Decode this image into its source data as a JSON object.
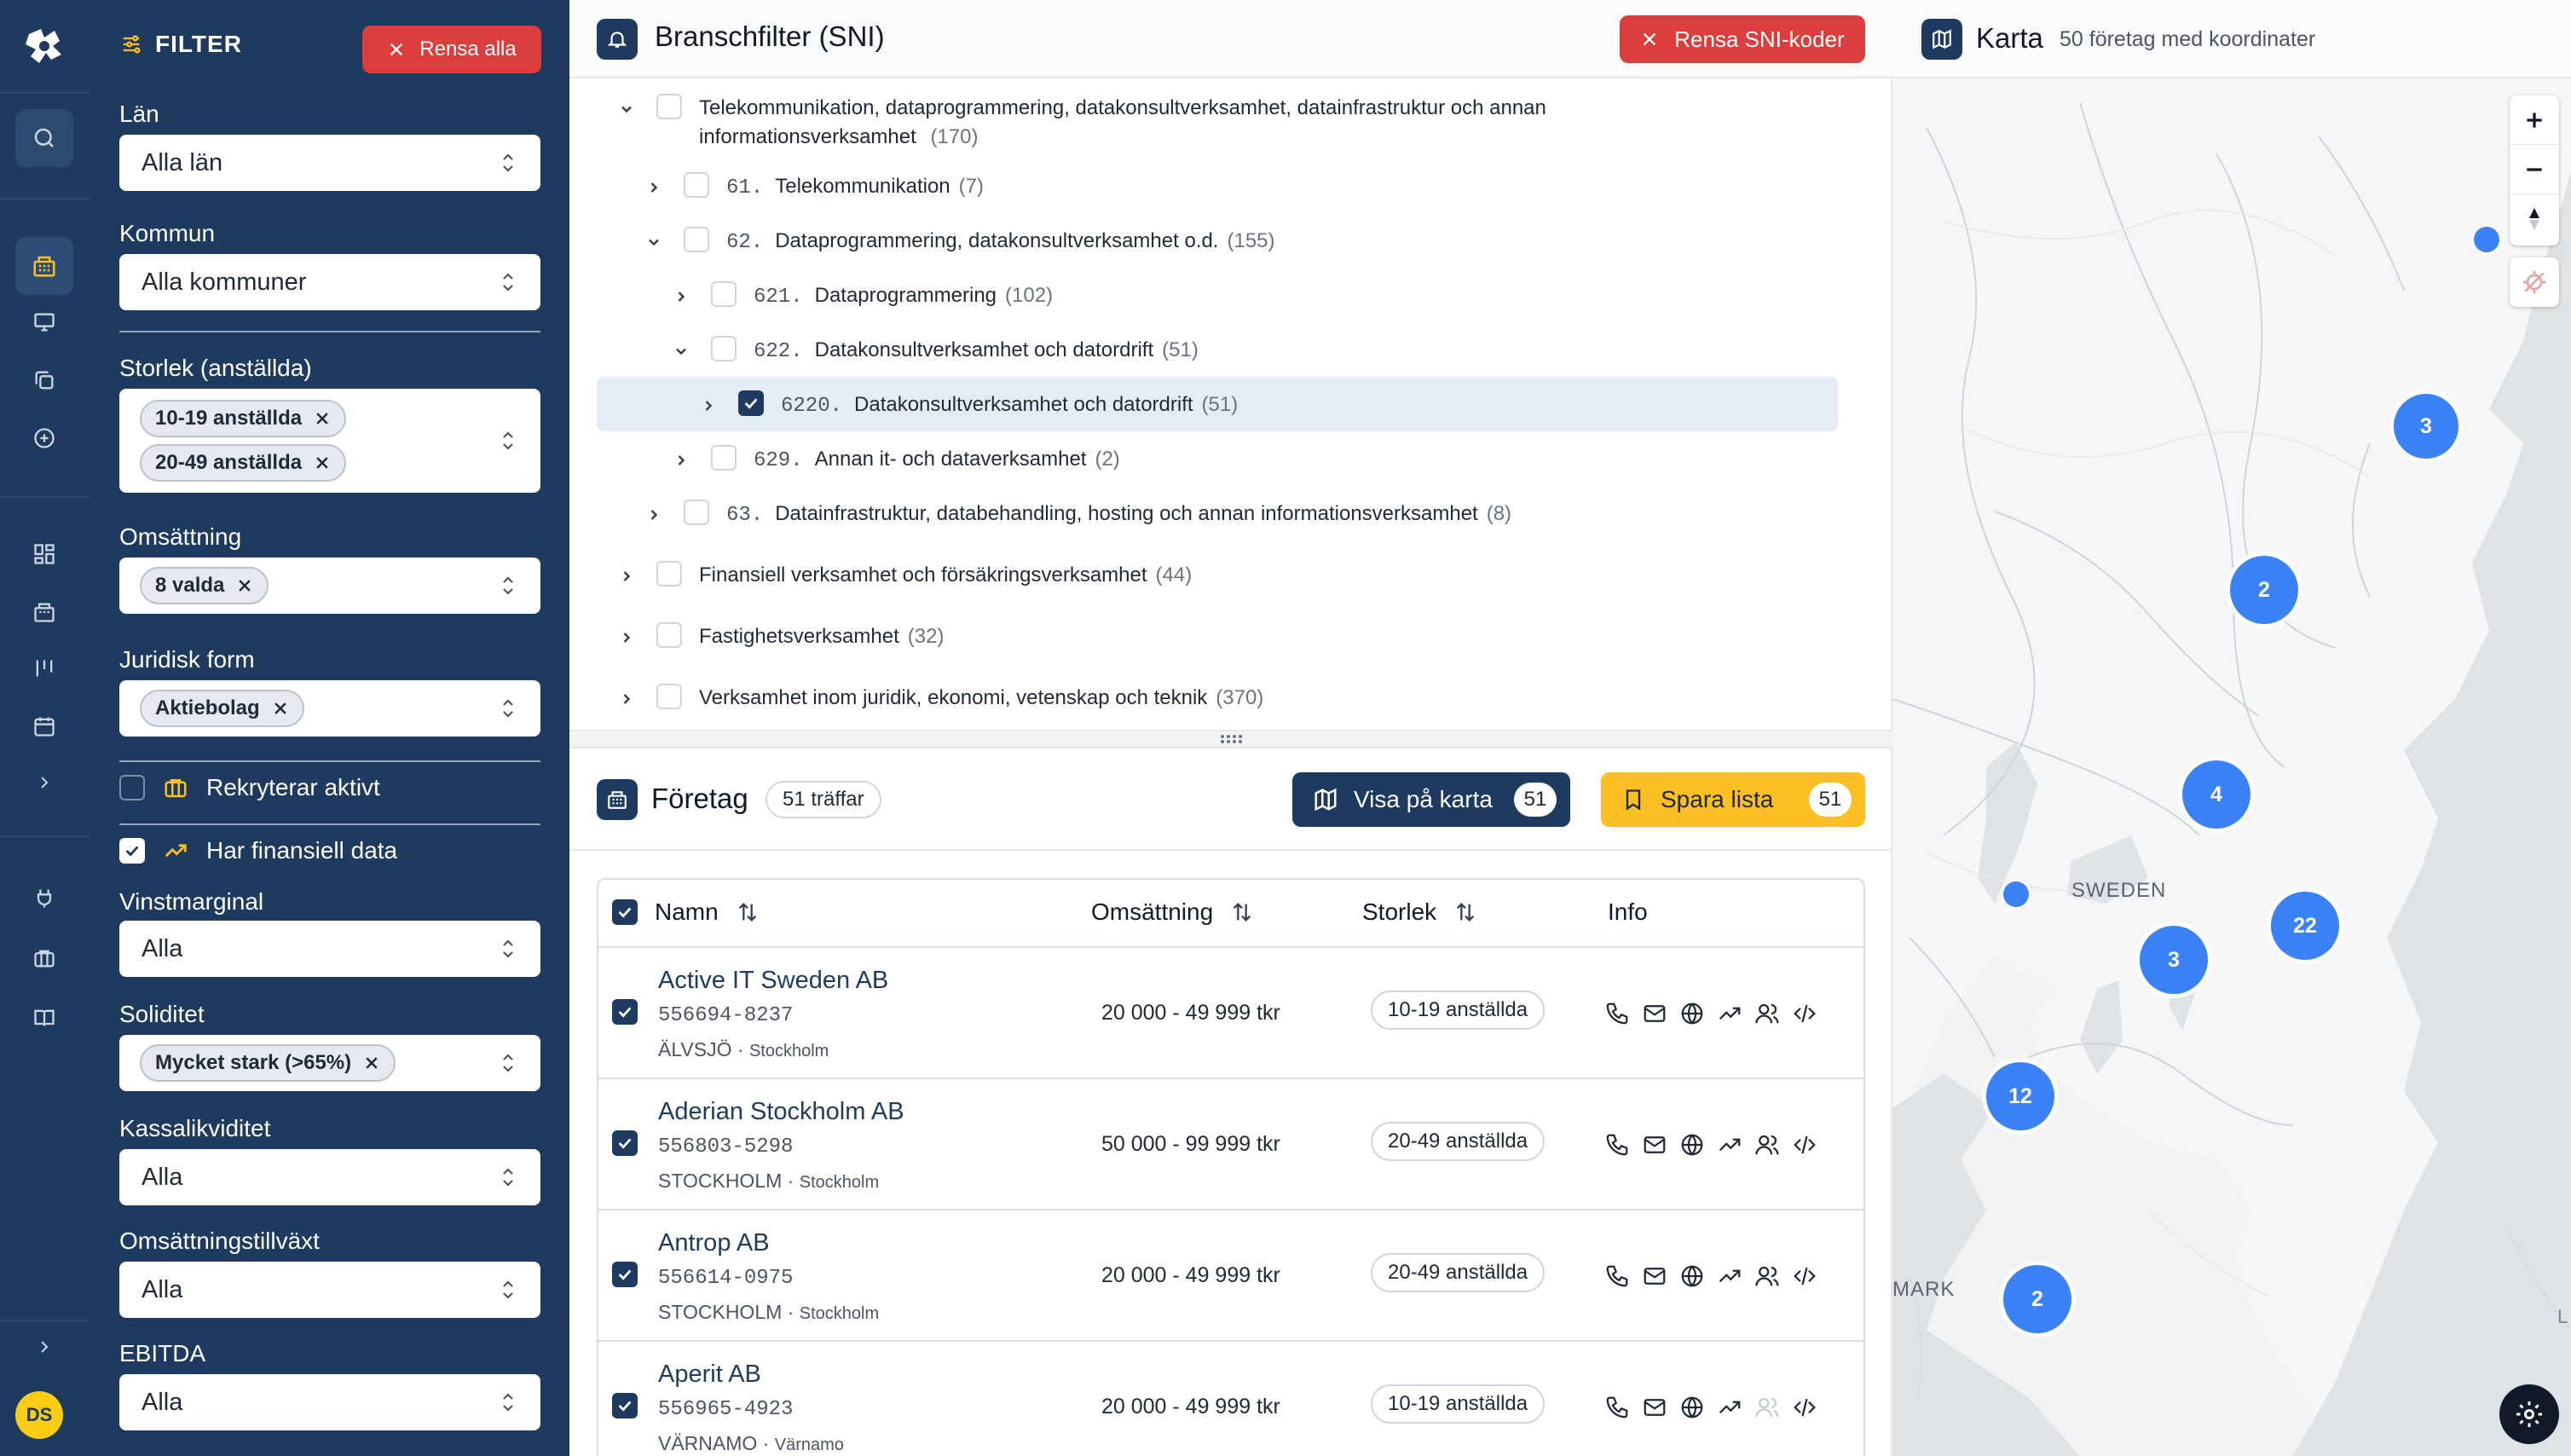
{
  "rail": {
    "avatar_initials": "DS"
  },
  "filter": {
    "title": "FILTER",
    "clear_all": "Rensa alla",
    "lan_label": "Län",
    "lan_value": "Alla län",
    "kommun_label": "Kommun",
    "kommun_value": "Alla kommuner",
    "storlek_label": "Storlek (anställda)",
    "storlek_chips": [
      "10-19 anställda",
      "20-49 anställda"
    ],
    "omsattning_label": "Omsättning",
    "omsattning_chip": "8 valda",
    "juridisk_label": "Juridisk form",
    "juridisk_chip": "Aktiebolag",
    "rekryterar_label": "Rekryterar aktivt",
    "finansiell_label": "Har finansiell data",
    "vinst_label": "Vinstmarginal",
    "vinst_value": "Alla",
    "soliditet_label": "Soliditet",
    "soliditet_chip": "Mycket stark (>65%)",
    "kassa_label": "Kassalikviditet",
    "kassa_value": "Alla",
    "tillvaxt_label": "Omsättningstillväxt",
    "tillvaxt_value": "Alla",
    "ebitda_label": "EBITDA",
    "ebitda_value": "Alla"
  },
  "sni": {
    "title": "Branschfilter (SNI)",
    "clear_button": "Rensa SNI-koder",
    "rows": [
      {
        "code": "",
        "label": "Telekommunikation, dataprogrammering, datakonsultverksamhet, datainfrastruktur och annan",
        "label2": "informationsverksamhet",
        "count": "(170)"
      },
      {
        "code": "61.",
        "label": "Telekommunikation",
        "count": "(7)"
      },
      {
        "code": "62.",
        "label": "Dataprogrammering, datakonsultverksamhet o.d.",
        "count": "(155)"
      },
      {
        "code": "621.",
        "label": "Dataprogrammering",
        "count": "(102)"
      },
      {
        "code": "622.",
        "label": "Datakonsultverksamhet och datordrift",
        "count": "(51)"
      },
      {
        "code": "6220.",
        "label": "Datakonsultverksamhet och datordrift",
        "count": "(51)"
      },
      {
        "code": "629.",
        "label": "Annan it- och dataverksamhet",
        "count": "(2)"
      },
      {
        "code": "63.",
        "label": "Datainfrastruktur, databehandling, hosting och annan informationsverksamhet",
        "count": "(8)"
      },
      {
        "code": "",
        "label": "Finansiell verksamhet och försäkringsverksamhet",
        "count": "(44)"
      },
      {
        "code": "",
        "label": "Fastighetsverksamhet",
        "count": "(32)"
      },
      {
        "code": "",
        "label": "Verksamhet inom juridik, ekonomi, vetenskap och teknik",
        "count": "(370)"
      }
    ]
  },
  "companies": {
    "title": "Företag",
    "hits": "51 träffar",
    "show_map": "Visa på karta",
    "show_map_count": "51",
    "save_list": "Spara lista",
    "save_list_count": "51",
    "columns": {
      "name": "Namn",
      "revenue": "Omsättning",
      "size": "Storlek",
      "info": "Info"
    },
    "rows": [
      {
        "name": "Active IT Sweden AB",
        "org": "556694-8237",
        "city": "ÄLVSJÖ",
        "region": "Stockholm",
        "revenue": "20 000 - 49 999 tkr",
        "size": "10-19 anställda"
      },
      {
        "name": "Aderian Stockholm AB",
        "org": "556803-5298",
        "city": "STOCKHOLM",
        "region": "Stockholm",
        "revenue": "50 000 - 99 999 tkr",
        "size": "20-49 anställda"
      },
      {
        "name": "Antrop AB",
        "org": "556614-0975",
        "city": "STOCKHOLM",
        "region": "Stockholm",
        "revenue": "20 000 - 49 999 tkr",
        "size": "20-49 anställda"
      },
      {
        "name": "Aperit AB",
        "org": "556965-4923",
        "city": "VÄRNAMO",
        "region": "Värnamo",
        "revenue": "20 000 - 49 999 tkr",
        "size": "10-19 anställda"
      }
    ]
  },
  "map": {
    "title": "Karta",
    "subtitle": "50 företag med koordinater",
    "label_sweden": "SWEDEN",
    "label_mark": "MARK",
    "label_l": "L",
    "clusters": [
      "3",
      "2",
      "4",
      "22",
      "3",
      "12",
      "2"
    ]
  },
  "colors": {
    "navy": "#1e3a5f",
    "red": "#dc3e3e",
    "yellow": "#fbbf24",
    "cluster_blue": "#3b82f6"
  }
}
